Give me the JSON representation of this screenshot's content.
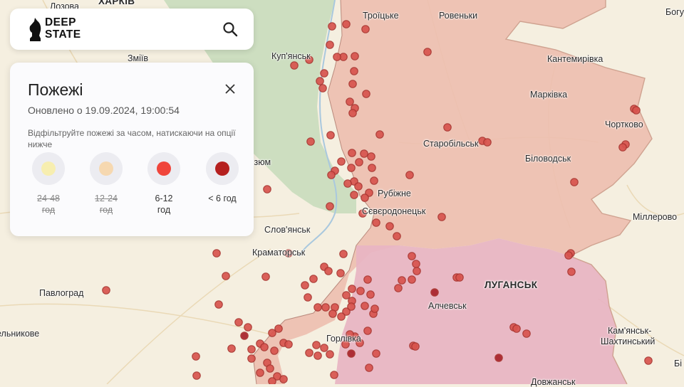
{
  "brand": {
    "name_line1": "DEEP",
    "name_line2": "STATE"
  },
  "search": {
    "icon": "search-icon"
  },
  "panel": {
    "title": "Пожежі",
    "updated": "Оновлено о 19.09.2024, 19:00:54",
    "hint": "Відфільтруйте пожежі за часом, натискаючи на опції нижче",
    "filters": [
      {
        "line1": "24-48",
        "line2": "год",
        "color": "#f7eeb0",
        "active": false
      },
      {
        "line1": "12-24",
        "line2": "год",
        "color": "#f6d8b0",
        "active": false
      },
      {
        "line1": "6-12",
        "line2": "год",
        "color": "#f0453b",
        "active": true
      },
      {
        "line1": "< 6 год",
        "line2": "",
        "color": "#b5201f",
        "active": true
      }
    ]
  },
  "map": {
    "colors": {
      "base": "#f5efe0",
      "free_ukraine_green": "#c9dbbd",
      "occupied_since_2022": "#edbfb0",
      "occupied_since_2014": "#e8b5c3",
      "fire_fill": "#d8544e",
      "fire_stroke": "#a83530",
      "fire_recent_fill": "#a8232a"
    },
    "cities": [
      {
        "name": "ХАРКІВ"
      },
      {
        "name": "Лозова"
      },
      {
        "name": "Троїцьке"
      },
      {
        "name": "Ровеньки"
      },
      {
        "name": "Богу"
      },
      {
        "name": "Зміїв"
      },
      {
        "name": "Куп'янськ"
      },
      {
        "name": "Кантемирівка"
      },
      {
        "name": "Марківка"
      },
      {
        "name": "Чортково"
      },
      {
        "name": "Старобільськ"
      },
      {
        "name": "Біловодськ"
      },
      {
        "name": "Ізюм"
      },
      {
        "name": "Рубіжне"
      },
      {
        "name": "Сєвєродонецьк"
      },
      {
        "name": "Міллерово"
      },
      {
        "name": "Слов'янськ"
      },
      {
        "name": "Краматорськ"
      },
      {
        "name": "Павлоград"
      },
      {
        "name": "ЛУГАНСЬК"
      },
      {
        "name": "Алчевськ"
      },
      {
        "name": "Горлівка"
      },
      {
        "name": "Кам'янськ-"
      },
      {
        "name": "Шахтинський"
      },
      {
        "name": "Довжанськ"
      },
      {
        "name": "Бі"
      },
      {
        "name": "ельникове"
      }
    ]
  }
}
